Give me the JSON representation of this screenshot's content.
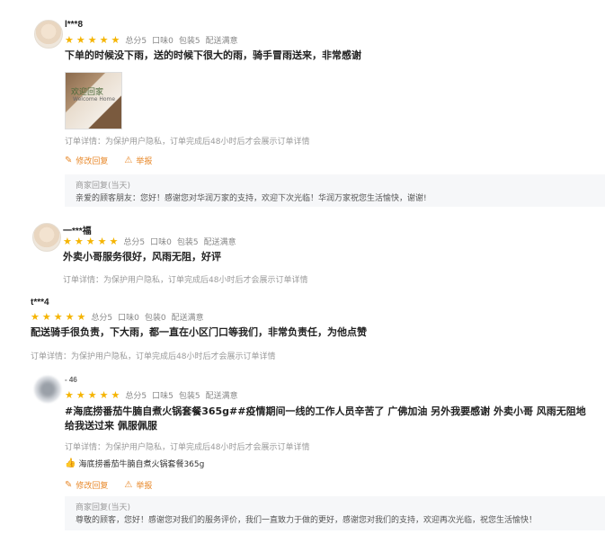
{
  "reviews": [
    {
      "user": "l***8",
      "rating": 5,
      "scores": [
        "总分5",
        "口味0",
        "包装5",
        "配送满意"
      ],
      "content": "下单的时候没下雨，送的时候下很大的雨，骑手冒雨送来，非常感谢",
      "photo_text": "欢迎回家",
      "photo_subtext": "Welcome Home",
      "detail": "订单详情：为保护用户隐私，订单完成后48小时后才会展示订单详情",
      "actions": [
        "修改回复",
        "举报"
      ],
      "reply_label": "商家回复(当天)",
      "reply_text": "亲爱的顾客朋友：您好！感谢您对华润万家的支持，欢迎下次光临！华润万家祝您生活愉快，谢谢!"
    },
    {
      "user": "一***福",
      "rating": 5,
      "scores": [
        "总分5",
        "口味0",
        "包装5",
        "配送满意"
      ],
      "content": "外卖小哥服务很好，风雨无阻，好评",
      "detail": "订单详情：为保护用户隐私，订单完成后48小时后才会展示订单详情"
    },
    {
      "user": "t***4",
      "rating": 5,
      "scores": [
        "总分5",
        "口味0",
        "包装0",
        "配送满意"
      ],
      "content": "配送骑手很负责，下大雨，都一直在小区门口等我们，非常负责任，为他点赞",
      "detail": "订单详情：为保护用户隐私，订单完成后48小时后才会展示订单详情"
    },
    {
      "user": "-    46",
      "rating": 5,
      "scores": [
        "总分5",
        "口味5",
        "包装5",
        "配送满意"
      ],
      "content_line1": "#海底捞番茄牛腩自煮火锅套餐365g##疫情期间一线的工作人员辛苦了 广佛加油 另外我要感谢 外卖小哥 风雨无阻地",
      "content_line2": "给我送过来 佩服佩服",
      "detail": "订单详情：为保护用户隐私，订单完成后48小时后才会展示订单详情",
      "dish": "海底捞番茄牛腩自煮火锅套餐365g",
      "actions": [
        "修改回复",
        "举报"
      ],
      "reply_label": "商家回复(当天)",
      "reply_text": "尊敬的顾客，您好！感谢您对我们的服务评价，我们一直致力于做的更好，感谢您对我们的支持，欢迎再次光临，祝您生活愉快！"
    }
  ],
  "icons": {
    "star": "★",
    "edit": "✎",
    "report": "⚠",
    "thumb": "👍"
  },
  "colors": {
    "star": "#f5b400",
    "action": "#e8892b"
  }
}
